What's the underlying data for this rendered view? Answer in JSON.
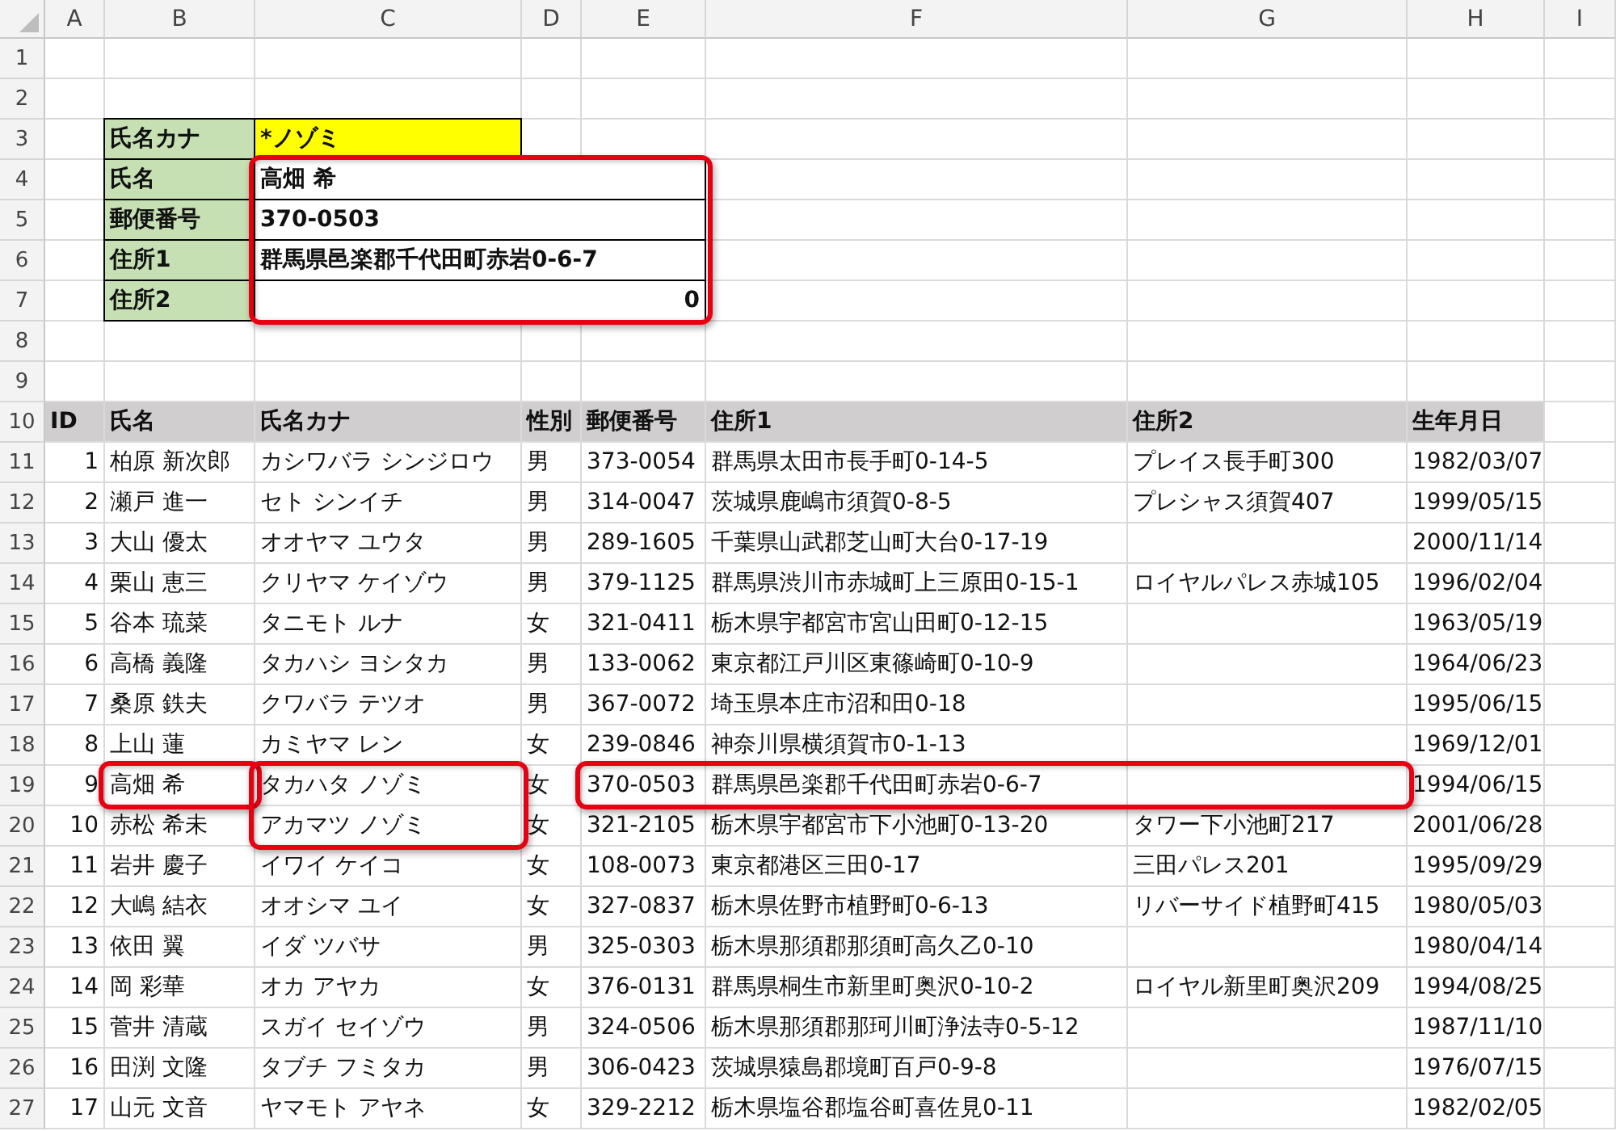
{
  "column_headers": [
    "A",
    "B",
    "C",
    "D",
    "E",
    "F",
    "G",
    "H",
    "I"
  ],
  "row_numbers": [
    "1",
    "2",
    "3",
    "4",
    "5",
    "6",
    "7",
    "8",
    "9",
    "10",
    "11",
    "12",
    "13",
    "14",
    "15",
    "16",
    "17",
    "18",
    "19",
    "20",
    "21",
    "22",
    "23",
    "24",
    "25",
    "26",
    "27"
  ],
  "lookup": {
    "framed": true,
    "rows": [
      {
        "kind": "criteria",
        "label": "氏名カナ",
        "value": "*ノゾミ"
      },
      {
        "kind": "text",
        "label": "氏名",
        "value": "高畑 希"
      },
      {
        "kind": "text",
        "label": "郵便番号",
        "value": "370-0503"
      },
      {
        "kind": "text",
        "label": "住所1",
        "value": "群馬県邑楽郡千代田町赤岩0-6-7"
      },
      {
        "kind": "number",
        "label": "住所2",
        "value": "0"
      }
    ]
  },
  "table": {
    "columns": [
      "ID",
      "氏名",
      "氏名カナ",
      "性別",
      "郵便番号",
      "住所1",
      "住所2",
      "生年月日"
    ],
    "rows": [
      {
        "id": "1",
        "name": "柏原 新次郎",
        "kana": "カシワバラ シンジロウ",
        "gender": "男",
        "zip": "373-0054",
        "address1": "群馬県太田市長手町0-14-5",
        "address2": "プレイス長手町300",
        "birth_date": "1982/03/07",
        "frame": {
          "name": false,
          "kana": false,
          "address": false
        }
      },
      {
        "id": "2",
        "name": "瀬戸 進一",
        "kana": "セト シンイチ",
        "gender": "男",
        "zip": "314-0047",
        "address1": "茨城県鹿嶋市須賀0-8-5",
        "address2": "プレシャス須賀407",
        "birth_date": "1999/05/15",
        "frame": {
          "name": false,
          "kana": false,
          "address": false
        }
      },
      {
        "id": "3",
        "name": "大山 優太",
        "kana": "オオヤマ ユウタ",
        "gender": "男",
        "zip": "289-1605",
        "address1": "千葉県山武郡芝山町大台0-17-19",
        "birth_date": "2000/11/14",
        "frame": {
          "name": false,
          "kana": false,
          "address": false
        }
      },
      {
        "id": "4",
        "name": "栗山 恵三",
        "kana": "クリヤマ ケイゾウ",
        "gender": "男",
        "zip": "379-1125",
        "address1": "群馬県渋川市赤城町上三原田0-15-1",
        "address2": "ロイヤルパレス赤城105",
        "birth_date": "1996/02/04",
        "frame": {
          "name": false,
          "kana": false,
          "address": false
        }
      },
      {
        "id": "5",
        "name": "谷本 琉菜",
        "kana": "タニモト ルナ",
        "gender": "女",
        "zip": "321-0411",
        "address1": "栃木県宇都宮市宮山田町0-12-15",
        "birth_date": "1963/05/19",
        "frame": {
          "name": false,
          "kana": false,
          "address": false
        }
      },
      {
        "id": "6",
        "name": "高橋 義隆",
        "kana": "タカハシ ヨシタカ",
        "gender": "男",
        "zip": "133-0062",
        "address1": "東京都江戸川区東篠崎町0-10-9",
        "birth_date": "1964/06/23",
        "frame": {
          "name": false,
          "kana": false,
          "address": false
        }
      },
      {
        "id": "7",
        "name": "桑原 鉄夫",
        "kana": "クワバラ テツオ",
        "gender": "男",
        "zip": "367-0072",
        "address1": "埼玉県本庄市沼和田0-18",
        "birth_date": "1995/06/15",
        "frame": {
          "name": false,
          "kana": false,
          "address": false
        }
      },
      {
        "id": "8",
        "name": "上山 蓮",
        "kana": "カミヤマ レン",
        "gender": "女",
        "zip": "239-0846",
        "address1": "神奈川県横須賀市0-1-13",
        "birth_date": "1969/12/01",
        "frame": {
          "name": false,
          "kana": false,
          "address": false
        }
      },
      {
        "id": "9",
        "name": "高畑 希",
        "kana": "タカハタ ノゾミ",
        "gender": "女",
        "zip": "370-0503",
        "address1": "群馬県邑楽郡千代田町赤岩0-6-7",
        "birth_date": "1994/06/15",
        "frame": {
          "name": true,
          "kana": true,
          "address": true
        }
      },
      {
        "id": "10",
        "name": "赤松 希未",
        "kana": "アカマツ ノゾミ",
        "gender": "女",
        "zip": "321-2105",
        "address1": "栃木県宇都宮市下小池町0-13-20",
        "address2": "タワー下小池町217",
        "birth_date": "2001/06/28",
        "frame": {
          "name": false,
          "kana": true,
          "address": false
        }
      },
      {
        "id": "11",
        "name": "岩井 慶子",
        "kana": "イワイ ケイコ",
        "gender": "女",
        "zip": "108-0073",
        "address1": "東京都港区三田0-17",
        "address2": "三田パレス201",
        "birth_date": "1995/09/29",
        "frame": {
          "name": false,
          "kana": false,
          "address": false
        }
      },
      {
        "id": "12",
        "name": "大嶋 結衣",
        "kana": "オオシマ ユイ",
        "gender": "女",
        "zip": "327-0837",
        "address1": "栃木県佐野市植野町0-6-13",
        "address2": "リバーサイド植野町415",
        "birth_date": "1980/05/03",
        "frame": {
          "name": false,
          "kana": false,
          "address": false
        }
      },
      {
        "id": "13",
        "name": "依田 翼",
        "kana": "イダ ツバサ",
        "gender": "男",
        "zip": "325-0303",
        "address1": "栃木県那須郡那須町高久乙0-10",
        "birth_date": "1980/04/14",
        "frame": {
          "name": false,
          "kana": false,
          "address": false
        }
      },
      {
        "id": "14",
        "name": "岡 彩華",
        "kana": "オカ アヤカ",
        "gender": "女",
        "zip": "376-0131",
        "address1": "群馬県桐生市新里町奥沢0-10-2",
        "address2": "ロイヤル新里町奥沢209",
        "birth_date": "1994/08/25",
        "frame": {
          "name": false,
          "kana": false,
          "address": false
        }
      },
      {
        "id": "15",
        "name": "菅井 清蔵",
        "kana": "スガイ セイゾウ",
        "gender": "男",
        "zip": "324-0506",
        "address1": "栃木県那須郡那珂川町浄法寺0-5-12",
        "birth_date": "1987/11/10",
        "frame": {
          "name": false,
          "kana": false,
          "address": false
        }
      },
      {
        "id": "16",
        "name": "田渕 文隆",
        "kana": "タブチ フミタカ",
        "gender": "男",
        "zip": "306-0423",
        "address1": "茨城県猿島郡境町百戸0-9-8",
        "birth_date": "1976/07/15",
        "frame": {
          "name": false,
          "kana": false,
          "address": false
        }
      },
      {
        "id": "17",
        "name": "山元 文音",
        "kana": "ヤマモト アヤネ",
        "gender": "女",
        "zip": "329-2212",
        "address1": "栃木県塩谷郡塩谷町喜佐見0-11",
        "birth_date": "1982/02/05",
        "frame": {
          "name": false,
          "kana": false,
          "address": false
        }
      }
    ]
  }
}
